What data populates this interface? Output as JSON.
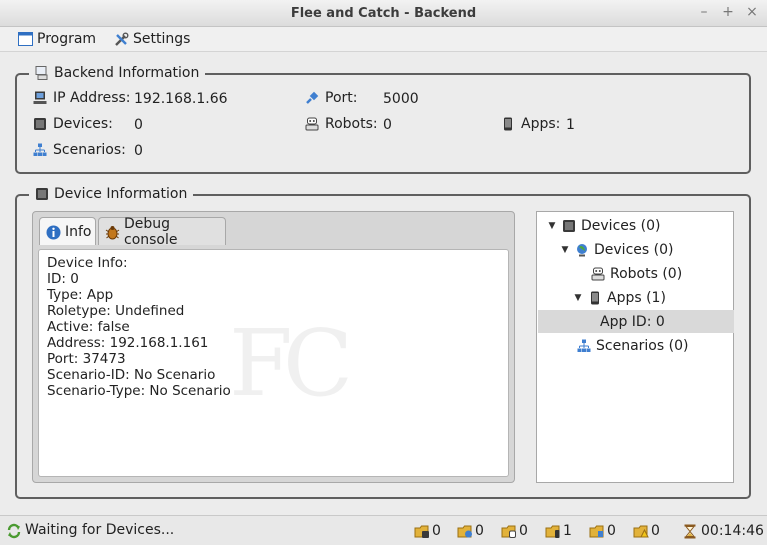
{
  "window": {
    "title": "Flee and Catch - Backend",
    "controls": [
      "–",
      "+",
      "×"
    ]
  },
  "menu": {
    "program": "Program",
    "settings": "Settings"
  },
  "backend": {
    "title": "Backend Information",
    "ip_label": "IP Address:",
    "ip_value": "192.168.1.66",
    "port_label": "Port:",
    "port_value": "5000",
    "devices_label": "Devices:",
    "devices_value": "0",
    "robots_label": "Robots:",
    "robots_value": "0",
    "apps_label": "Apps:",
    "apps_value": "1",
    "scenarios_label": "Scenarios:",
    "scenarios_value": "0"
  },
  "device": {
    "title": "Device Information",
    "tabs": {
      "info": "Info",
      "debug": "Debug console"
    },
    "info_lines": [
      "Device Info:",
      "ID: 0",
      "Type: App",
      "Roletype: Undefined",
      "Active: false",
      "Address: 192.168.1.161",
      "Port: 37473",
      "Scenario-ID: No Scenario",
      "Scenario-Type: No Scenario"
    ],
    "watermark": "FC"
  },
  "tree": {
    "root": "Devices (0)",
    "devices": "Devices (0)",
    "robots": "Robots (0)",
    "apps": "Apps (1)",
    "app_item": "App ID: 0",
    "scenarios": "Scenarios (0)"
  },
  "status": {
    "message": "Waiting for Devices...",
    "counters": [
      "0",
      "0",
      "0",
      "1",
      "0",
      "0"
    ],
    "time": "00:14:46"
  },
  "colors": {
    "accent_blue": "#2f6fc2",
    "device_dark": "#3a3a3a",
    "selection": "#d9d9d9"
  }
}
